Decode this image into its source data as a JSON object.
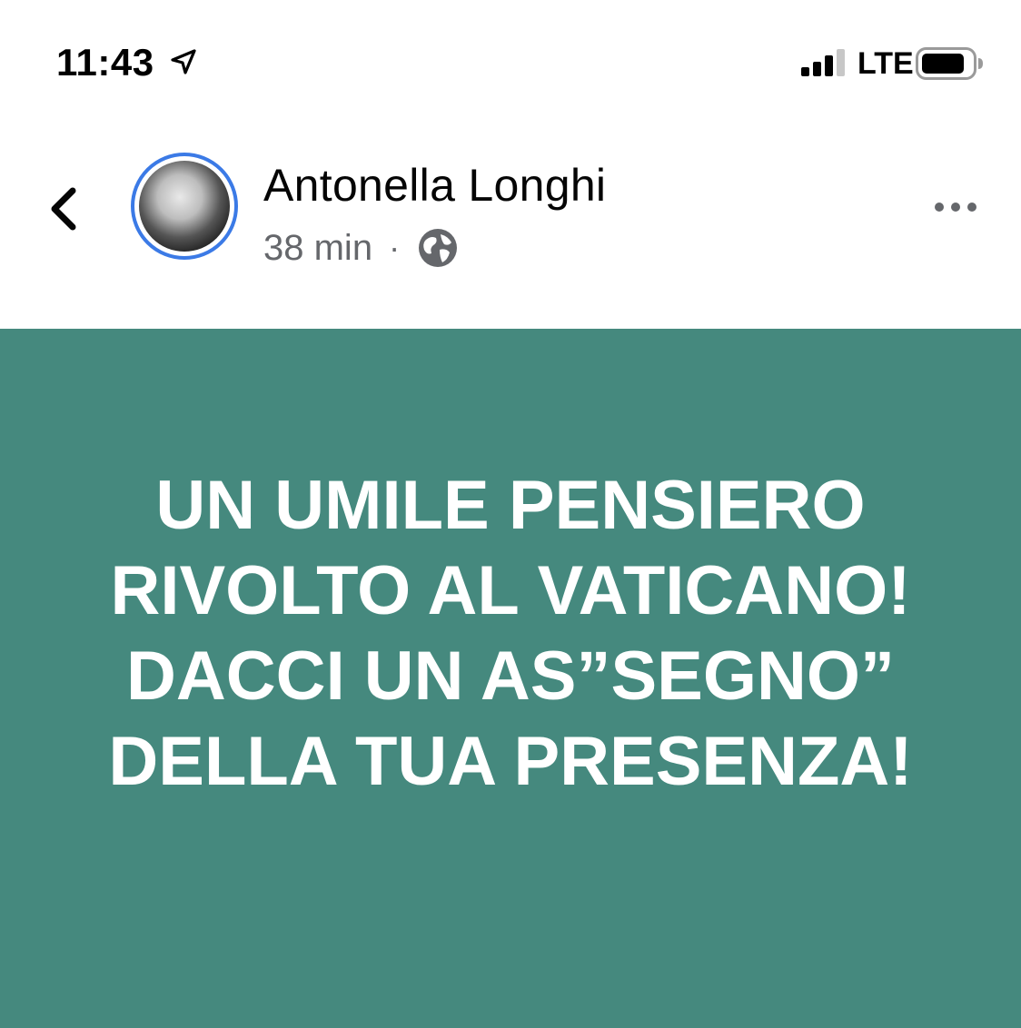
{
  "status_bar": {
    "time": "11:43",
    "network": "LTE",
    "icons": [
      "location-arrow-icon",
      "cellular-signal-icon",
      "battery-icon"
    ]
  },
  "post": {
    "author": "Antonella Longhi",
    "timestamp": "38 min",
    "separator": "·",
    "privacy_icon": "globe-icon",
    "text": "UN UMILE PENSIERO RIVOLTO AL VATICANO! DACCI UN AS”SEGNO” DELLA TUA PRESENZA!",
    "background_color": "#45897e",
    "text_color": "#ffffff"
  },
  "header": {
    "back_icon": "chevron-left-icon",
    "more_icon": "more-dots-icon",
    "avatar_ring_color": "#3b7ae6"
  }
}
